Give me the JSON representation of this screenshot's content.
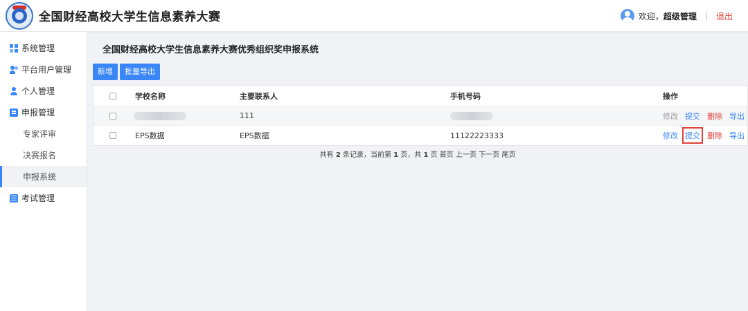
{
  "app": {
    "title": "全国财经高校大学生信息素养大赛"
  },
  "user": {
    "welcome": "欢迎，",
    "name": "超级管理",
    "separator": "|",
    "logout": "退出"
  },
  "sidebar": {
    "items": [
      {
        "label": "系统管理",
        "icon": "grid-icon"
      },
      {
        "label": "平台用户管理",
        "icon": "users-icon"
      },
      {
        "label": "个人管理",
        "icon": "user-icon"
      },
      {
        "label": "申报管理",
        "icon": "document-icon"
      }
    ],
    "subitems": [
      "专家评审",
      "决赛报名",
      "申报系统"
    ],
    "bottom_item": {
      "label": "考试管理",
      "icon": "exam-icon"
    }
  },
  "main": {
    "title": "全国财经高校大学生信息素养大赛优秀组织奖申报系统",
    "buttons": {
      "add": "新增",
      "export": "批量导出"
    },
    "table": {
      "headers": [
        "学校名称",
        "主要联系人",
        "手机号码",
        "操作"
      ],
      "rows": [
        {
          "school": "",
          "contact": "111",
          "phone": "",
          "ops": [
            "修改",
            "提交",
            "删除",
            "导出"
          ]
        },
        {
          "school": "EPS数据",
          "contact": "EPS数据",
          "phone": "11122223333",
          "ops": [
            "修改",
            "提交",
            "删除",
            "导出"
          ]
        }
      ]
    },
    "pager": {
      "p1": "共有 ",
      "total": "2",
      "p2": " 条记录，当前第 ",
      "current": "1",
      "p3": " 页，共 ",
      "pages": "1",
      "p4": " 页 ",
      "first": "首页",
      "prev": "上一页",
      "next": "下一页",
      "last": "尾页"
    }
  },
  "colors": {
    "accent": "#3b86f6",
    "danger": "#e0403a"
  }
}
